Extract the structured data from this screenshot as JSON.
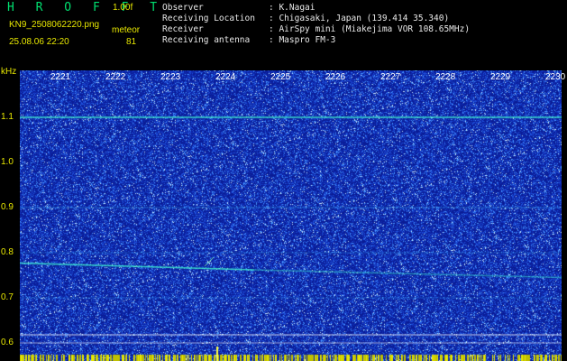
{
  "header": {
    "app_title": "H R O F F T",
    "version": "1.00f",
    "filename": "KN9_2508062220.png",
    "meteor_label": "meteor",
    "datetime": "25.08.06 22:20",
    "meteor_count": "81",
    "info": [
      {
        "key": "Observer",
        "value": ": K.Nagai"
      },
      {
        "key": "Receiving Location",
        "value": ": Chigasaki, Japan (139.414 35.340)"
      },
      {
        "key": "Receiver",
        "value": ": AirSpy mini (Miakejima VOR 108.65MHz)"
      },
      {
        "key": "Receiving antenna",
        "value": ": Maspro FM-3"
      }
    ]
  },
  "axis": {
    "unit": "kHz",
    "y_labels": [
      "1.1",
      "1.0",
      "0.9",
      "0.8",
      "0.7",
      "0.6"
    ],
    "y_values": [
      1.1,
      1.0,
      0.9,
      0.8,
      0.7,
      0.6
    ],
    "time_labels": [
      "2221",
      "2222",
      "2223",
      "2224",
      "2225",
      "2226",
      "2227",
      "2228",
      "2229",
      "2230"
    ]
  },
  "colors": {
    "background": "#0a1a8c",
    "noise": "#3a8cff",
    "signal": "#40ffd0",
    "label_yellow": "#e8e800"
  }
}
